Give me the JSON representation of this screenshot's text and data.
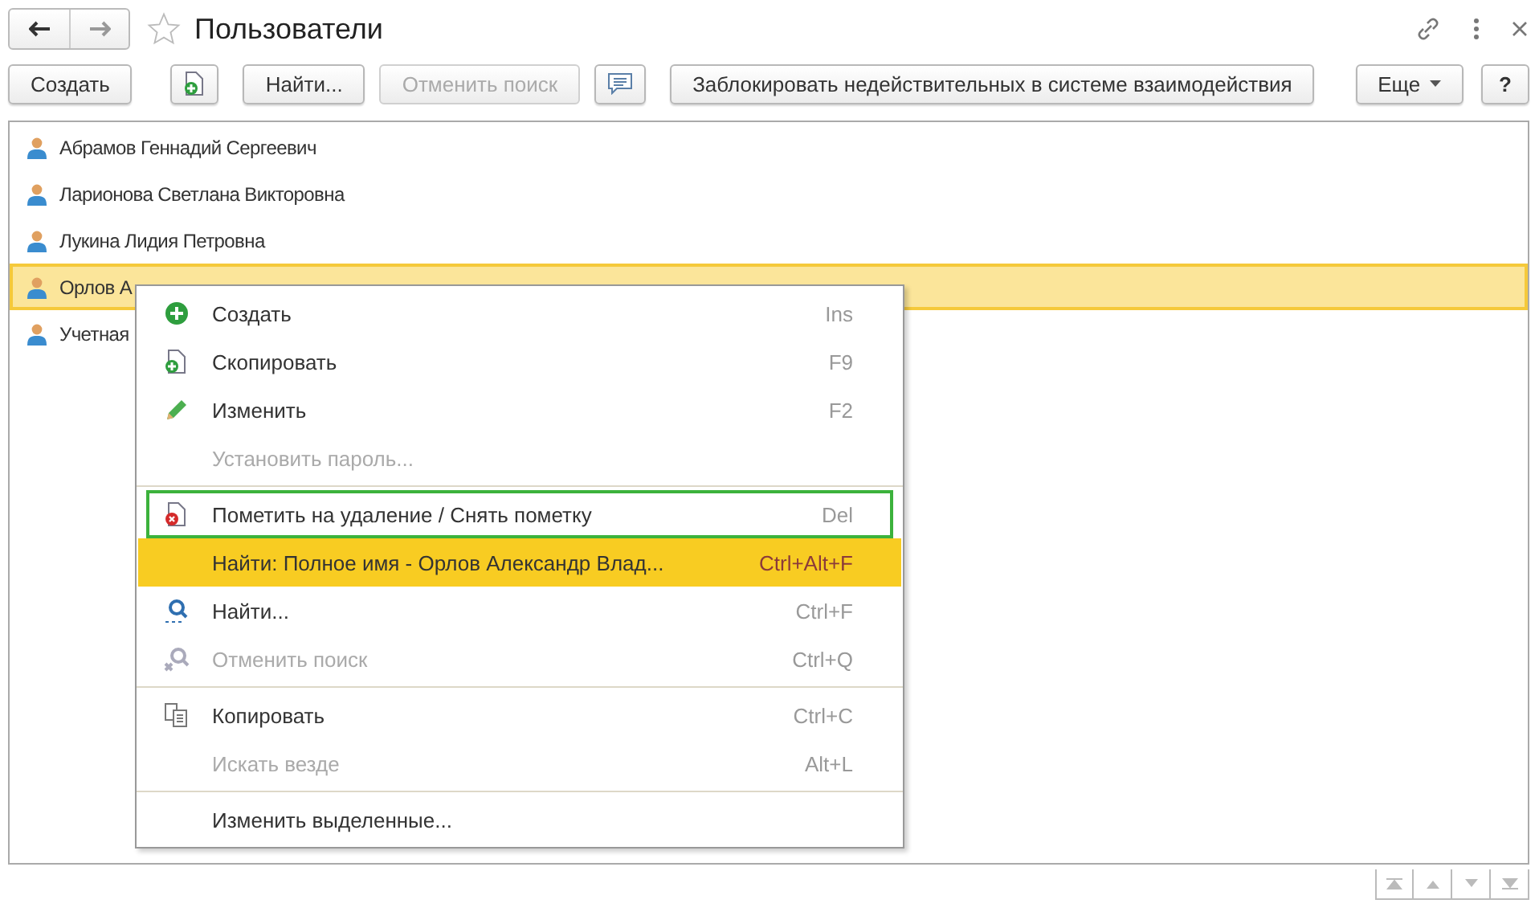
{
  "window": {
    "title": "Пользователи",
    "favorite": false
  },
  "toolbar": [
    {
      "kind": "text",
      "label": "Создать",
      "disabled": false
    },
    {
      "kind": "add-doc",
      "disabled": false
    },
    {
      "kind": "text",
      "label": "Найти...",
      "disabled": false
    },
    {
      "kind": "text",
      "label": "Отменить поиск",
      "disabled": true
    },
    {
      "kind": "comment",
      "disabled": false
    },
    {
      "kind": "text",
      "label": "Заблокировать недействительных в системе взаимодействия",
      "disabled": false
    }
  ],
  "more_button": {
    "label": "Еще"
  },
  "help_button": {
    "label": "?"
  },
  "users": [
    {
      "name": "Абрамов Геннадий Сергеевич",
      "selected": false
    },
    {
      "name": "Ларионова Светлана Викторовна",
      "selected": false
    },
    {
      "name": "Лукина Лидия Петровна",
      "selected": false
    },
    {
      "name": "Орлов А",
      "selected": true
    },
    {
      "name": "Учетная",
      "selected": false
    }
  ],
  "context_menu": {
    "groups": [
      [
        {
          "kind": "add",
          "label": "Создать",
          "shortcut": "Ins",
          "disabled": false,
          "selected": false,
          "outlined": false
        },
        {
          "kind": "copy",
          "label": "Скопировать",
          "shortcut": "F9",
          "disabled": false,
          "selected": false,
          "outlined": false
        },
        {
          "kind": "edit",
          "label": "Изменить",
          "shortcut": "F2",
          "disabled": false,
          "selected": false,
          "outlined": false
        },
        {
          "kind": "plain",
          "label": "Установить пароль...",
          "disabled": true,
          "selected": false,
          "outlined": false
        }
      ],
      [
        {
          "kind": "delete",
          "label": "Пометить на удаление / Снять пометку",
          "shortcut": "Del",
          "disabled": false,
          "selected": false,
          "outlined": true
        },
        {
          "kind": "plain",
          "label": "Найти: Полное имя - Орлов Александр Влад...",
          "shortcut": "Ctrl+Alt+F",
          "disabled": false,
          "selected": true,
          "outlined": false
        },
        {
          "kind": "find",
          "label": "Найти...",
          "shortcut": "Ctrl+F",
          "disabled": false,
          "selected": false,
          "outlined": false
        },
        {
          "kind": "unfind",
          "label": "Отменить поиск",
          "shortcut": "Ctrl+Q",
          "disabled": true,
          "selected": false,
          "outlined": false
        }
      ],
      [
        {
          "kind": "clipboard",
          "label": "Копировать",
          "shortcut": "Ctrl+C",
          "disabled": false,
          "selected": false,
          "outlined": false
        },
        {
          "kind": "plain",
          "label": "Искать везде",
          "shortcut": "Alt+L",
          "disabled": true,
          "selected": false,
          "outlined": false
        }
      ],
      [
        {
          "kind": "plain",
          "label": "Изменить выделенные...",
          "disabled": false,
          "selected": false,
          "outlined": false
        }
      ]
    ]
  }
}
